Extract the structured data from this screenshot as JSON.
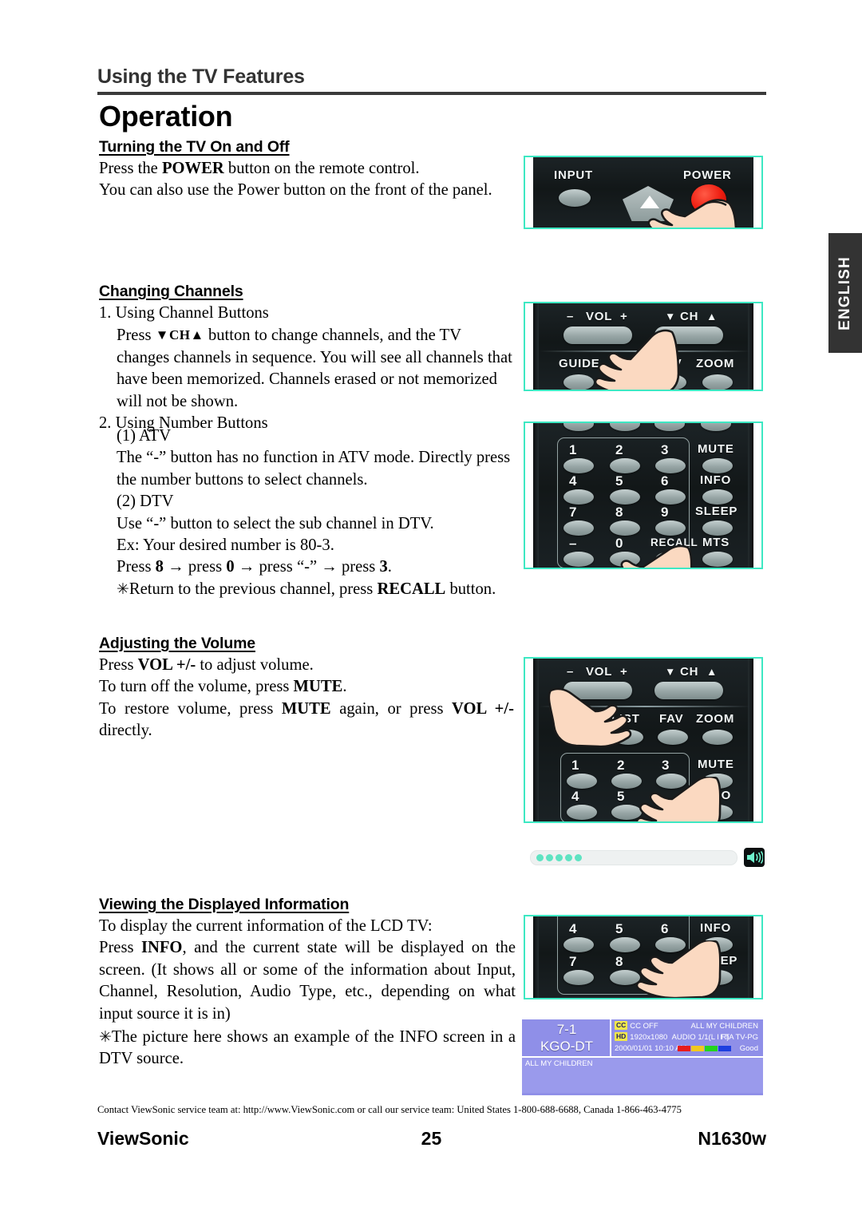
{
  "header": {
    "running_title": "Using the TV Features",
    "page_title": "Operation"
  },
  "side_tab": {
    "label": "ENGLISH"
  },
  "sections": {
    "power": {
      "heading": "Turning the TV On and Off",
      "line1_a": "Press the ",
      "line1_b": "POWER",
      "line1_c": " button on the remote control.",
      "line2": "You can also use the Power button on the front of the panel."
    },
    "channels": {
      "heading": "Changing Channels",
      "item1_title": "1. Using Channel Buttons",
      "item1_body_a": "Press ",
      "item1_body_tri": "▼CH▲",
      "item1_body_b": " button to change channels, and the TV changes channels in sequence. You will see all channels that have been memorized. Channels erased or not memorized will not be shown.",
      "item2_title": "2. Using Number Buttons",
      "atv_label": "(1) ATV",
      "atv_body": "The “-” button has no function in ATV mode. Directly press the number buttons to select channels.",
      "dtv_label": "(2) DTV",
      "dtv_body": "Use “-” button to select the sub channel in DTV.",
      "example": "Ex: Your desired number is 80-3.",
      "press_seq_1": "Press ",
      "press_seq_2": "8",
      "press_seq_3": " → press ",
      "press_seq_4": "0",
      "press_seq_5": " → press “-” → press ",
      "press_seq_6": "3",
      "press_seq_7": ".",
      "note_star": "✳",
      "note_a": "Return to the previous channel, press ",
      "note_b": "RECALL",
      "note_c": " button."
    },
    "volume": {
      "heading": "Adjusting the Volume",
      "l1_a": "Press ",
      "l1_b": "VOL +/-",
      "l1_c": " to adjust volume.",
      "l2_a": "To turn off the volume, press ",
      "l2_b": "MUTE",
      "l2_c": ".",
      "l3_a": "To restore volume, press ",
      "l3_b": "MUTE",
      "l3_c": " again, or press ",
      "l3_d": "VOL +/-",
      "l3_e": " directly."
    },
    "info": {
      "heading": "Viewing the Displayed Information",
      "l1": "To display the current information of the LCD TV:",
      "l2_a": "Press ",
      "l2_b": "INFO",
      "l2_c": ", and the current state will be displayed on the screen. (It shows all or some of the information about Input, Channel, Resolution, Audio Type, etc., depending on what input source it is in)",
      "note_star": "✳",
      "note": "The picture here shows an example of the INFO screen in a DTV source."
    }
  },
  "remote_panel_power": {
    "labels": {
      "input": "INPUT",
      "power": "POWER"
    }
  },
  "remote_panel_channel": {
    "labels": {
      "vol_minus": "–",
      "vol": "VOL",
      "vol_plus": "+",
      "ch_down": "▼",
      "ch": "CH",
      "ch_up": "▲",
      "guide": "GUIDE",
      "fav": "FAV",
      "zoom": "ZOOM"
    }
  },
  "remote_panel_keypad": {
    "keys": [
      [
        "1",
        "2",
        "3",
        "MUTE"
      ],
      [
        "4",
        "5",
        "6",
        "INFO"
      ],
      [
        "7",
        "8",
        "9",
        "SLEEP"
      ],
      [
        "–",
        "0",
        "RECALL",
        "MTS"
      ]
    ]
  },
  "remote_panel_volume": {
    "labels": {
      "vol_minus": "–",
      "vol": "VOL",
      "vol_plus": "+",
      "ch_down": "▼",
      "ch": "CH",
      "ch_up": "▲",
      "list": "LIST",
      "fav": "FAV",
      "zoom": "ZOOM",
      "mute": "MUTE",
      "info": "INFO"
    },
    "numbers": [
      [
        "1",
        "2",
        "3"
      ],
      [
        "4",
        "5",
        ""
      ]
    ]
  },
  "remote_panel_info": {
    "rows": [
      [
        "4",
        "5",
        "6",
        "INFO"
      ],
      [
        "7",
        "8",
        "",
        "SLEEP"
      ]
    ]
  },
  "volume_bar": {
    "filled_dots": 5,
    "icon": "speaker-icon"
  },
  "osd": {
    "channel_number": "7-1",
    "callsign": "KGO-DT",
    "cc_tag": "CC",
    "cc_text": "CC OFF",
    "hd_tag": "HD",
    "resolution": "1920x1080",
    "audio": "AUDIO  1/1(L I R)",
    "datetime": "2000/01/01  10:10  AM",
    "program_title": "ALL MY CHILDREN",
    "rating": "FTA TV-PG",
    "signal_quality": "Good",
    "signal_colors": [
      "#e81b1b",
      "#f2c81e",
      "#23d41e",
      "#1d3fe0"
    ],
    "body_title": "ALL MY CHILDREN"
  },
  "footer": {
    "contact": "Contact ViewSonic service team at: http://www.ViewSonic.com or call our service team: United States 1-800-688-6688, Canada 1-866-463-4775",
    "brand": "ViewSonic",
    "page_number": "25",
    "model": "N1630w"
  },
  "colors": {
    "panel_border": "#3de8c3",
    "osd_bg": "#8f8fe8",
    "power_button": "#ee1d10",
    "side_tab": "#333333"
  }
}
